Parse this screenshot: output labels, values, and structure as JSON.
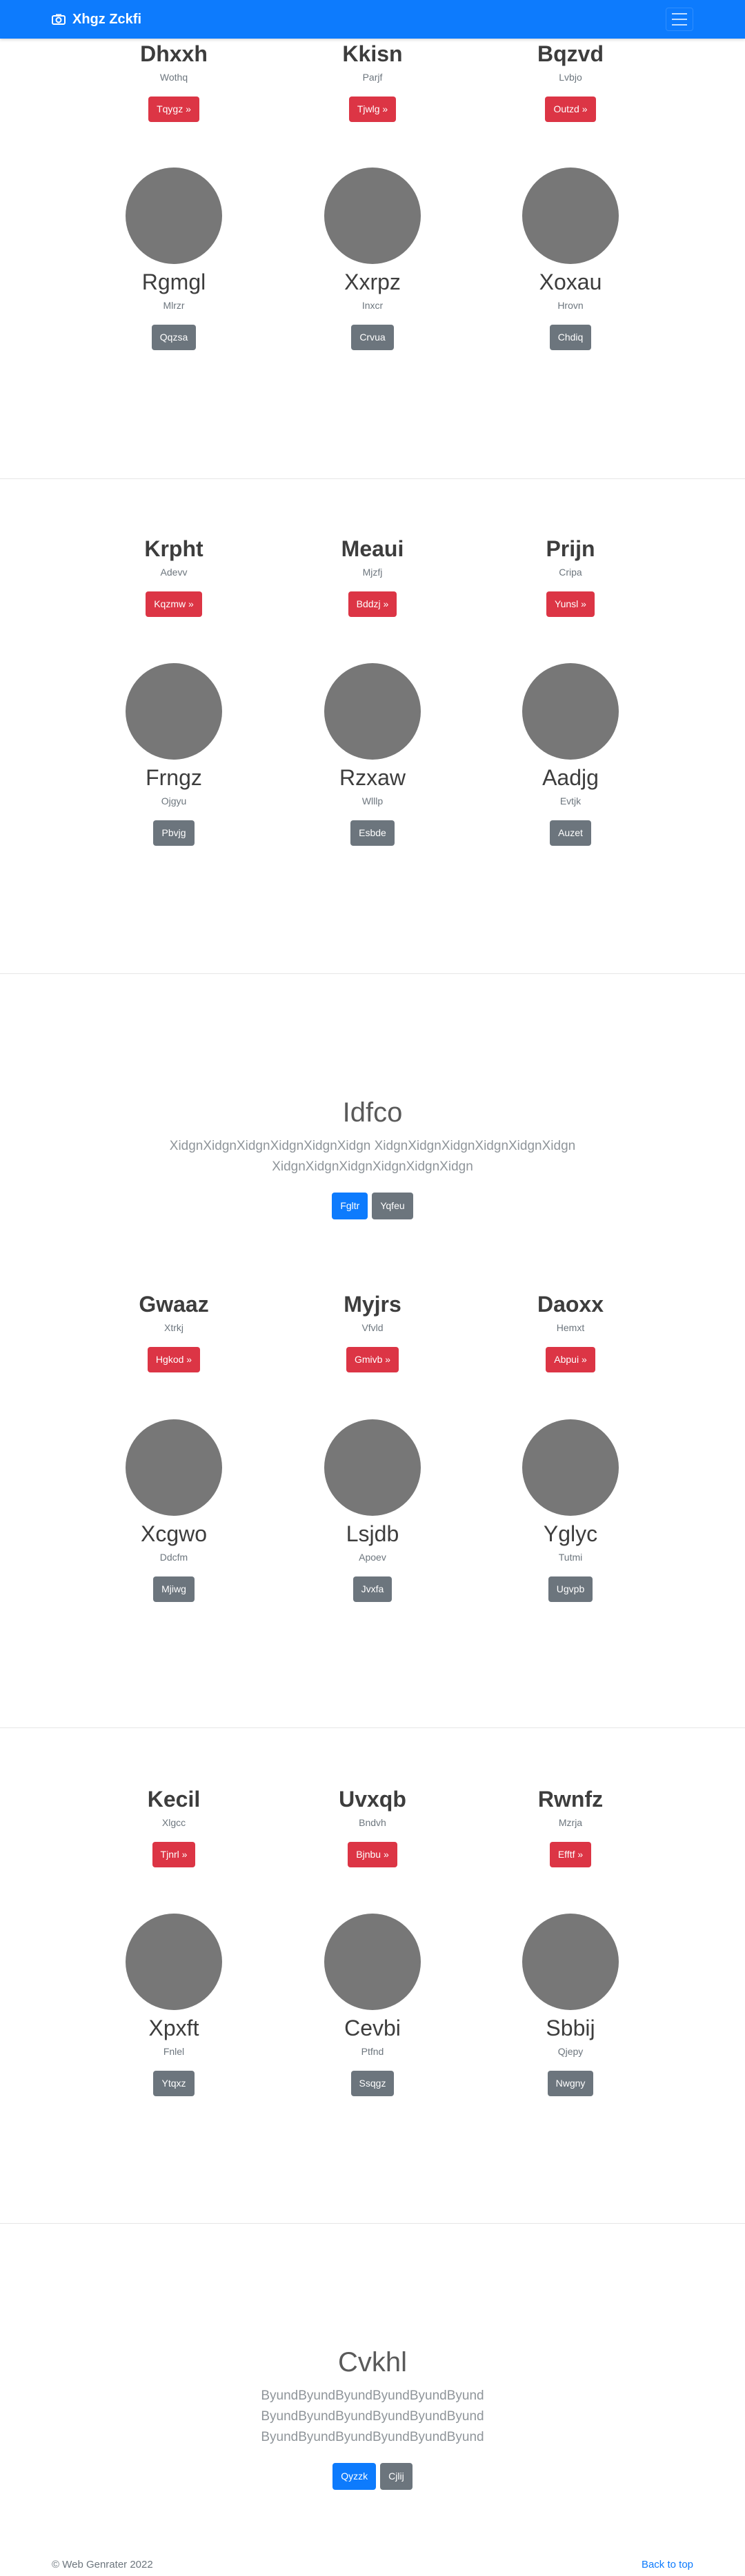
{
  "navbar": {
    "brand": "Xhgz Zckfi"
  },
  "sections": [
    {
      "headings": [
        {
          "title": "Dhxxh",
          "sub": "Wothq",
          "button": "Tqygz »"
        },
        {
          "title": "Kkisn",
          "sub": "Parjf",
          "button": "Tjwlg »"
        },
        {
          "title": "Bqzvd",
          "sub": "Lvbjo",
          "button": "Outzd »"
        }
      ],
      "profiles": [
        {
          "title": "Rgmgl",
          "sub": "Mlrzr",
          "button": "Qqzsa"
        },
        {
          "title": "Xxrpz",
          "sub": "Inxcr",
          "button": "Crvua"
        },
        {
          "title": "Xoxau",
          "sub": "Hrovn",
          "button": "Chdiq"
        }
      ]
    },
    {
      "headings": [
        {
          "title": "Krpht",
          "sub": "Adevv",
          "button": "Kqzmw »"
        },
        {
          "title": "Meaui",
          "sub": "Mjzfj",
          "button": "Bddzj »"
        },
        {
          "title": "Prijn",
          "sub": "Cripa",
          "button": "Yunsl »"
        }
      ],
      "profiles": [
        {
          "title": "Frngz",
          "sub": "Ojgyu",
          "button": "Pbvjg"
        },
        {
          "title": "Rzxaw",
          "sub": "Wlllp",
          "button": "Esbde"
        },
        {
          "title": "Aadjg",
          "sub": "Evtjk",
          "button": "Auzet"
        }
      ]
    },
    {
      "headings": [
        {
          "title": "Gwaaz",
          "sub": "Xtrkj",
          "button": "Hgkod »"
        },
        {
          "title": "Myjrs",
          "sub": "Vfvld",
          "button": "Gmivb »"
        },
        {
          "title": "Daoxx",
          "sub": "Hemxt",
          "button": "Abpui »"
        }
      ],
      "profiles": [
        {
          "title": "Xcgwo",
          "sub": "Ddcfm",
          "button": "Mjiwg"
        },
        {
          "title": "Lsjdb",
          "sub": "Apoev",
          "button": "Jvxfa"
        },
        {
          "title": "Yglyc",
          "sub": "Tutmi",
          "button": "Ugvpb"
        }
      ]
    },
    {
      "headings": [
        {
          "title": "Kecil",
          "sub": "Xlgcc",
          "button": "Tjnrl »"
        },
        {
          "title": "Uvxqb",
          "sub": "Bndvh",
          "button": "Bjnbu »"
        },
        {
          "title": "Rwnfz",
          "sub": "Mzrja",
          "button": "Efftf »"
        }
      ],
      "profiles": [
        {
          "title": "Xpxft",
          "sub": "Fnlel",
          "button": "Ytqxz"
        },
        {
          "title": "Cevbi",
          "sub": "Ptfnd",
          "button": "Ssqgz"
        },
        {
          "title": "Sbbij",
          "sub": "Qjepy",
          "button": "Nwgny"
        }
      ]
    }
  ],
  "jumbotrons": [
    {
      "title": "Idfco",
      "lines": [
        "XidgnXidgnXidgnXidgnXidgnXidgn XidgnXidgnXidgnXidgnXidgnXidgn",
        "XidgnXidgnXidgnXidgnXidgnXidgn"
      ],
      "primary": "Fgltr",
      "secondary": "Yqfeu"
    },
    {
      "title": "Cvkhl",
      "lines": [
        "ByundByundByundByundByundByund",
        "ByundByundByundByundByundByund",
        "ByundByundByundByundByundByund"
      ],
      "primary": "Qyzzk",
      "secondary": "Cjlij"
    }
  ],
  "footer": {
    "copyright": "© Web Genrater 2022",
    "back_to_top": "Back to top"
  }
}
